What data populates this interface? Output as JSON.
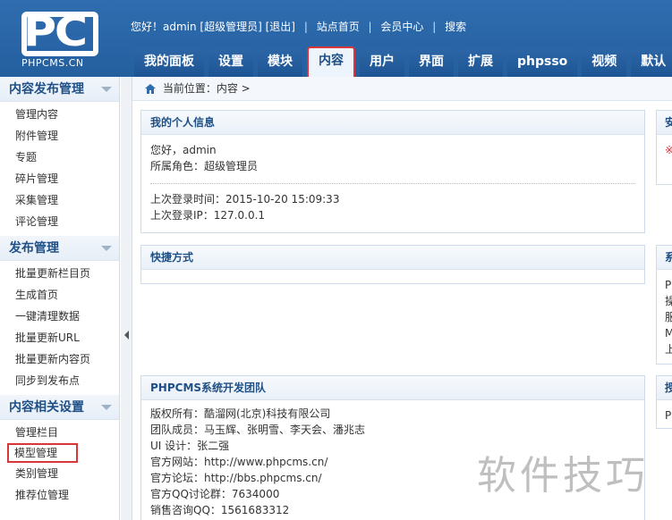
{
  "logo": {
    "brand": "PC",
    "sub": "PHPCMS.CN"
  },
  "topnav": {
    "greeting": "您好！admin [超级管理员]",
    "logout": "[退出]",
    "site_home": "站点首页",
    "member_center": "会员中心",
    "search": "搜索"
  },
  "menu": [
    {
      "label": "我的面板"
    },
    {
      "label": "设置"
    },
    {
      "label": "模块"
    },
    {
      "label": "内容"
    },
    {
      "label": "用户"
    },
    {
      "label": "界面"
    },
    {
      "label": "扩展"
    },
    {
      "label": "phpsso"
    },
    {
      "label": "视频"
    },
    {
      "label": "默认"
    }
  ],
  "sidebar": {
    "sections": [
      {
        "title": "内容发布管理",
        "items": [
          "管理内容",
          "附件管理",
          "专题",
          "碎片管理",
          "采集管理",
          "评论管理"
        ]
      },
      {
        "title": "发布管理",
        "items": [
          "批量更新栏目页",
          "生成首页",
          "一键清理数据",
          "批量更新URL",
          "批量更新内容页",
          "同步到发布点"
        ]
      },
      {
        "title": "内容相关设置",
        "items": [
          "管理栏目",
          "模型管理",
          "类别管理",
          "推荐位管理"
        ]
      }
    ]
  },
  "breadcrumb": {
    "text": "当前位置：内容 >"
  },
  "panels": {
    "personal": {
      "title": "我的个人信息",
      "hello": "您好，admin",
      "role": "所属角色：超级管理员",
      "last_login_time": "上次登录时间：2015-10-20 15:09:33",
      "last_login_ip": "上次登录IP：127.0.0.1"
    },
    "shortcut": {
      "title": "快捷方式"
    },
    "team": {
      "title": "PHPCMS系统开发团队",
      "lines": [
        "版权所有：酷溜网(北京)科技有限公司",
        "团队成员：马玉辉、张明雪、李天会、潘兆志",
        "UI 设计：张二强",
        "官方网站：http://www.phpcms.cn/",
        "官方论坛：http://bbs.phpcms.cn/",
        "官方QQ讨论群：7634000",
        "销售咨询QQ：1561683312"
      ]
    },
    "right1": {
      "title": "安",
      "body": "※"
    },
    "right2": {
      "title": "系",
      "lines": [
        "P",
        "操",
        "服",
        "M",
        "上"
      ]
    },
    "right3": {
      "title": "授",
      "lines": [
        "P"
      ]
    }
  },
  "watermark": "软件技巧"
}
